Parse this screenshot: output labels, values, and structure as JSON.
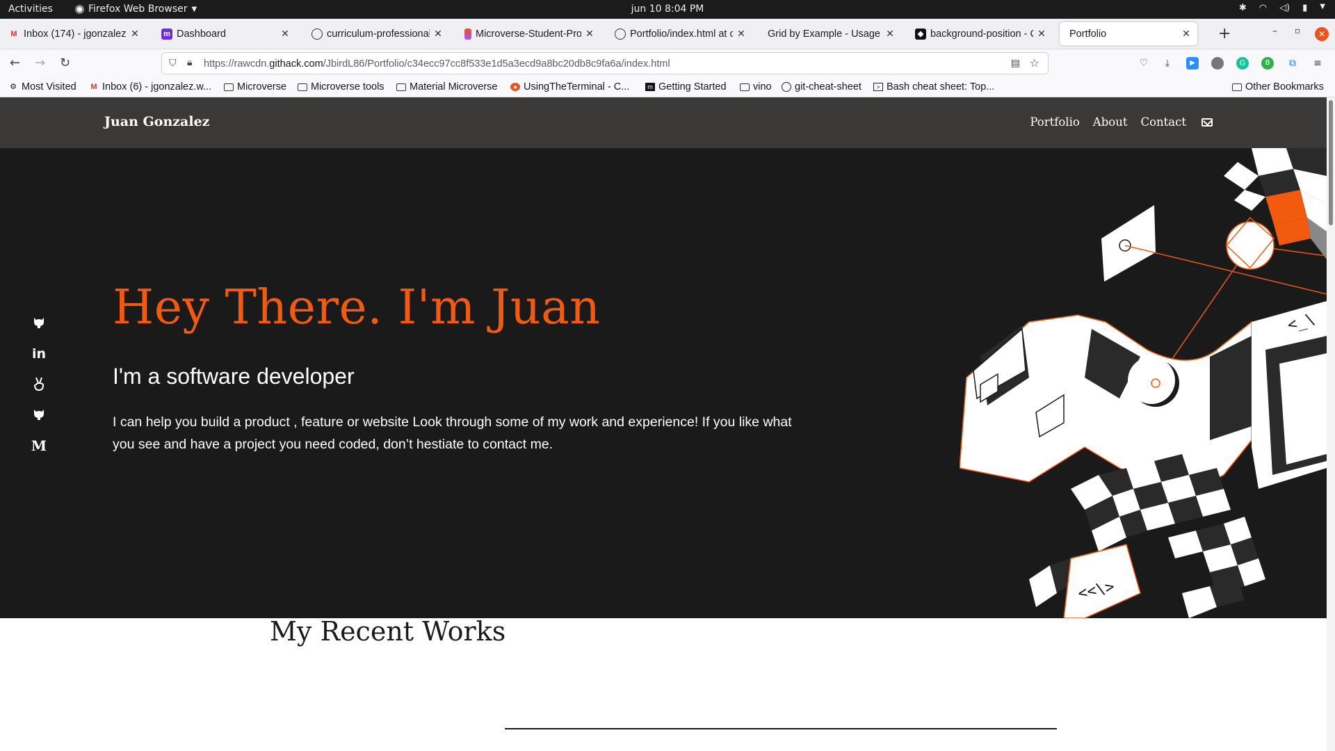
{
  "system": {
    "activities": "Activities",
    "app_name": "Firefox Web Browser",
    "clock": "jun 10  8:04 PM"
  },
  "tabs": [
    {
      "label": "Inbox (174) - jgonzalez.w",
      "icon": "gmail-icon"
    },
    {
      "label": "Dashboard",
      "icon": "dashboard-icon"
    },
    {
      "label": "curriculum-professional",
      "icon": "github-icon"
    },
    {
      "label": "Microverse-Student-Pro",
      "icon": "figma-icon"
    },
    {
      "label": "Portfolio/index.html at c",
      "icon": "github-icon"
    },
    {
      "label": "Grid by Example - Usage ex",
      "icon": "page-icon"
    },
    {
      "label": "background-position - C",
      "icon": "codepen-icon"
    },
    {
      "label": "Portfolio",
      "icon": "none"
    }
  ],
  "url": {
    "prefix": "https://rawcdn.",
    "domain": "githack.com",
    "path": "/JbirdL86/Portfolio/c34ecc97cc8f533e1d5a3ecd9a8bc20db8c9fa6a/index.html"
  },
  "bookmarks": [
    {
      "label": "Most Visited",
      "icon": "gear-icon"
    },
    {
      "label": "Inbox (6) - jgonzalez.w...",
      "icon": "gmail-icon"
    },
    {
      "label": "Microverse",
      "icon": "folder-icon"
    },
    {
      "label": "Microverse tools",
      "icon": "folder-icon"
    },
    {
      "label": "Material Microverse",
      "icon": "folder-icon"
    },
    {
      "label": "UsingTheTerminal - C...",
      "icon": "ubuntu-icon"
    },
    {
      "label": "Getting Started",
      "icon": "m-icon"
    },
    {
      "label": "vino",
      "icon": "folder-icon"
    },
    {
      "label": "git-cheat-sheet",
      "icon": "github-icon"
    },
    {
      "label": "Bash cheat sheet: Top...",
      "icon": "terminal-icon"
    }
  ],
  "other_bookmarks": "Other Bookmarks",
  "site": {
    "brand": "Juan Gonzalez",
    "nav": [
      "Portfolio",
      "About",
      "Contact"
    ],
    "hero": {
      "title": "Hey There. I'm Juan",
      "subtitle": "I'm a software developer",
      "description": "I can help you build a product , feature or website Look through some of my work and experience! If you like what you see and have a project you need coded, don’t hestiate to contact me."
    },
    "socials": [
      "github-icon",
      "linkedin-icon",
      "angellist-icon",
      "github-icon",
      "medium-icon"
    ],
    "medium_glyph": "M",
    "linkedin_glyph": "in",
    "art_text": [
      "<_\\",
      "<<\\>"
    ],
    "works_title": "My Recent Works"
  },
  "colors": {
    "accent": "#f15a0f",
    "hero_bg": "#1b1a1a",
    "header_bg": "#3a3938"
  }
}
